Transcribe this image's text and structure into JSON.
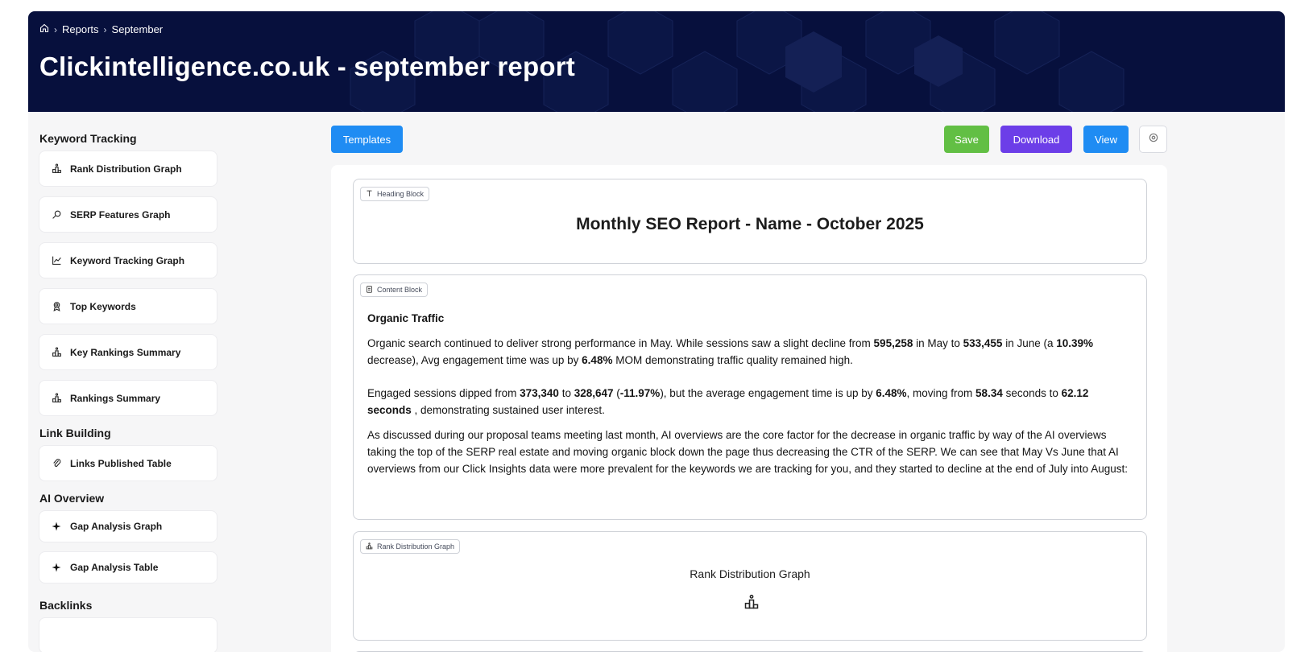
{
  "header": {
    "breadcrumb": [
      "Reports",
      "September"
    ],
    "title": "Clickintelligence.co.uk - september report"
  },
  "sidebar": {
    "groups": [
      {
        "title": "Keyword Tracking",
        "items": [
          {
            "label": "Rank Distribution Graph",
            "icon": "rank-icon"
          },
          {
            "label": "SERP Features Graph",
            "icon": "serp-icon"
          },
          {
            "label": "Keyword Tracking Graph",
            "icon": "line-chart-icon"
          },
          {
            "label": "Top Keywords",
            "icon": "award-icon"
          },
          {
            "label": "Key Rankings Summary",
            "icon": "rank-icon"
          },
          {
            "label": "Rankings Summary",
            "icon": "rank-icon"
          }
        ]
      },
      {
        "title": "Link Building",
        "items": [
          {
            "label": "Links Published Table",
            "icon": "paperclip-icon"
          }
        ]
      },
      {
        "title": "AI Overview",
        "items": [
          {
            "label": "Gap Analysis Graph",
            "icon": "sparkle-icon"
          },
          {
            "label": "Gap Analysis Table",
            "icon": "sparkle-icon"
          }
        ]
      },
      {
        "title": "Backlinks",
        "items": []
      }
    ]
  },
  "toolbar": {
    "templates": "Templates",
    "save": "Save",
    "download": "Download",
    "view": "View"
  },
  "blocks": {
    "heading": {
      "tag": "Heading Block",
      "text": "Monthly SEO Report - Name - October 2025"
    },
    "content": {
      "tag": "Content Block",
      "title": "Organic Traffic",
      "p1": {
        "a": "Organic search continued to deliver strong performance in May. While sessions saw a slight decline from ",
        "b1": "595,258",
        "c": " in May to ",
        "b2": "533,455",
        "d": " in June (a ",
        "b3": "10.39%",
        "e": " decrease), Avg engagement time was up by ",
        "b4": "6.48%",
        "f": " MOM demonstrating traffic quality remained high."
      },
      "p2": {
        "a": "Engaged sessions dipped from ",
        "b1": "373,340",
        "c": " to ",
        "b2": "328,647",
        "d": " (",
        "b3": "-11.97%",
        "e": "), but the average engagement time is up by ",
        "b4": "6.48%",
        "f": ", moving from ",
        "b5": "58.34",
        "g": " seconds to ",
        "b6": "62.12 seconds",
        "h": " , demonstrating sustained user interest."
      },
      "p3": " As discussed during our proposal teams meeting last month, AI overviews are the core factor for the decrease in organic traffic by way of the AI overviews taking the top of the SERP real estate and moving organic block down the page thus decreasing the CTR of the SERP. We can see that May Vs June that AI overviews from our Click Insights data were more prevalent for the keywords we are tracking for you, and they started to decline at the end of July into August:"
    },
    "rank": {
      "tag": "Rank Distribution Graph",
      "title": "Rank Distribution Graph"
    }
  },
  "colors": {
    "header_bg": "#07103d",
    "blue": "#1f8cf3",
    "green": "#62bf44",
    "purple": "#6c3ee8"
  }
}
